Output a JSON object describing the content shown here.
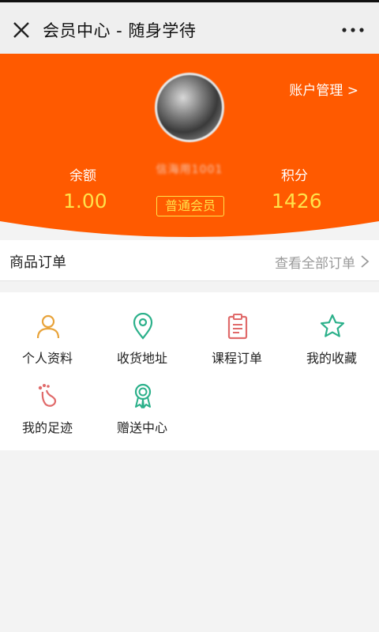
{
  "titlebar": {
    "title": "会员中心 - 随身学待",
    "close_icon": "close-icon",
    "more_icon": "more-icon"
  },
  "profile": {
    "account_manage": "账户管理 >",
    "username": "信海用1001",
    "balance_label": "余额",
    "balance_value": "1.00",
    "member_level": "普通会员",
    "points_label": "积分",
    "points_value": "1426",
    "accent_color": "#ff5a00",
    "value_color": "#ffe24a"
  },
  "orders": {
    "label": "商品订单",
    "view_all": "查看全部订单"
  },
  "menu": [
    {
      "label": "个人资料",
      "icon": "person-icon",
      "color": "#e8a33a"
    },
    {
      "label": "收货地址",
      "icon": "location-pin-icon",
      "color": "#2bb08a"
    },
    {
      "label": "课程订单",
      "icon": "clipboard-icon",
      "color": "#e06a6a"
    },
    {
      "label": "我的收藏",
      "icon": "star-icon",
      "color": "#2bb08a"
    },
    {
      "label": "我的足迹",
      "icon": "footprint-icon",
      "color": "#e06a6a"
    },
    {
      "label": "赠送中心",
      "icon": "award-icon",
      "color": "#2bb08a"
    }
  ]
}
